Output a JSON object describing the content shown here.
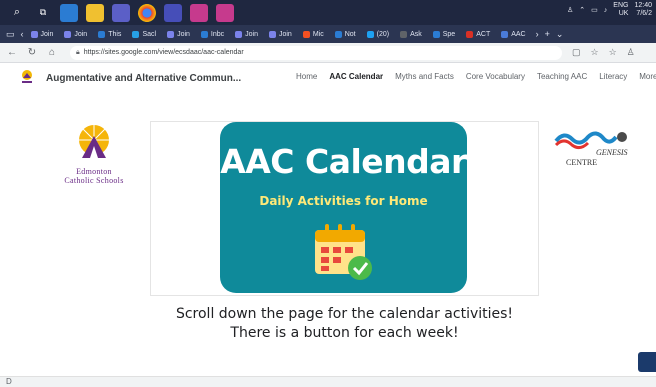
{
  "taskbar": {
    "icons": [
      "search-icon",
      "task-view-icon",
      "app-icon",
      "file-explorer-icon",
      "teams-icon",
      "chrome-icon",
      "app-icon",
      "app-icon",
      "app-icon"
    ],
    "time": "12:40",
    "date": "7/6/2",
    "lang_top": "ENG",
    "lang_bottom": "UK"
  },
  "tabs": [
    {
      "label": "Join",
      "color": "#7b83eb"
    },
    {
      "label": "Join",
      "color": "#7b83eb"
    },
    {
      "label": "This",
      "color": "#2b7cd3"
    },
    {
      "label": "Sacl",
      "color": "#27a0e6"
    },
    {
      "label": "Join",
      "color": "#7b83eb"
    },
    {
      "label": "Inbc",
      "color": "#2b7cd3"
    },
    {
      "label": "Join",
      "color": "#7b83eb"
    },
    {
      "label": "Join",
      "color": "#7b83eb"
    },
    {
      "label": "Mic",
      "color": "#f25022"
    },
    {
      "label": "Not",
      "color": "#2b7cd3"
    },
    {
      "label": "(20)",
      "color": "#1da1f2"
    },
    {
      "label": "Ask",
      "color": "#5f6368"
    },
    {
      "label": "Spe",
      "color": "#2b7cd3"
    },
    {
      "label": "ACT",
      "color": "#d93025"
    },
    {
      "label": "AAC",
      "color": "#4a7bd8"
    }
  ],
  "address": {
    "url": "https://sites.google.com/view/ecsdaac/aac-calendar"
  },
  "site": {
    "title": "Augmentative and Alternative Commun...",
    "nav": [
      {
        "label": "Home",
        "active": false
      },
      {
        "label": "AAC Calendar",
        "active": true
      },
      {
        "label": "Myths and Facts",
        "active": false
      },
      {
        "label": "Core Vocabulary",
        "active": false
      },
      {
        "label": "Teaching AAC",
        "active": false
      },
      {
        "label": "Literacy",
        "active": false
      },
      {
        "label": "More",
        "active": false
      }
    ]
  },
  "content": {
    "ecs_line1": "Edmonton",
    "ecs_line2": "Catholic Schools",
    "banner_title": "AAC Calendar",
    "banner_subtitle": "Daily Activities for Home",
    "genesis_line1": "GENESIS",
    "genesis_line2": "CENTRE",
    "scroll_line1": "Scroll down the page for the calendar activities!",
    "scroll_line2": "There is a button for each week!"
  },
  "colors": {
    "banner_teal": "#0f8a9a",
    "banner_sub_yellow": "#ffe978",
    "ecs_purple": "#6a2c86",
    "taskbar": "#1f2740"
  }
}
